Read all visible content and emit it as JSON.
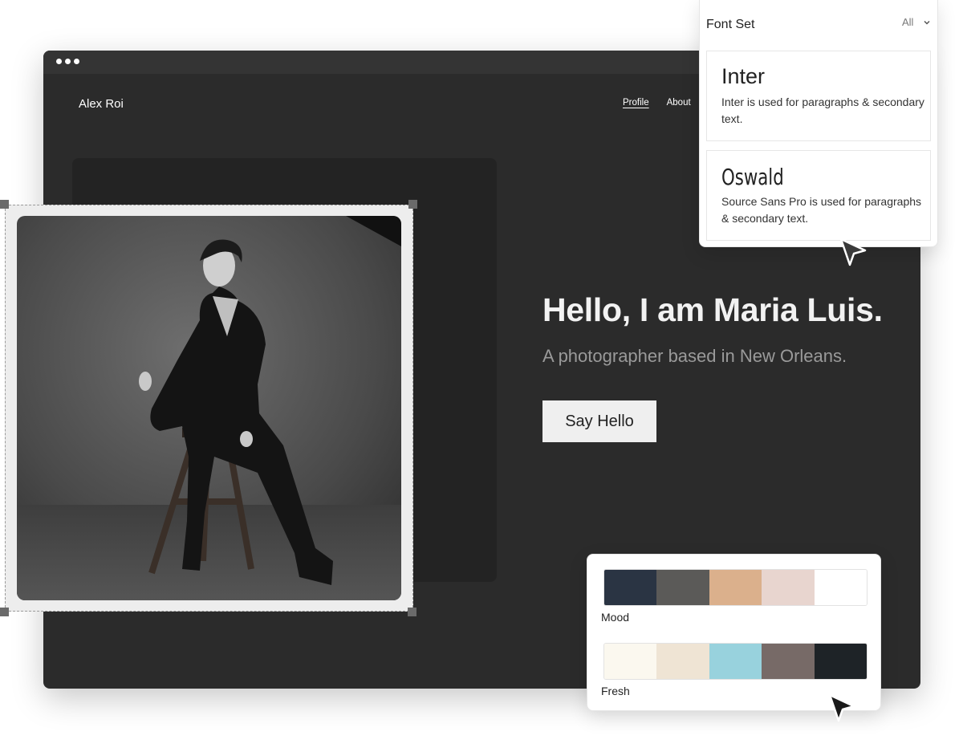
{
  "site": {
    "brand": "Alex Roi",
    "nav": [
      "Profile",
      "About"
    ],
    "hero_title": "Hello, I am Maria Luis.",
    "hero_subtitle": "A photographer based in New Orleans.",
    "cta_label": "Say Hello",
    "photo_icon": "portrait-photo-icon"
  },
  "font_panel": {
    "title": "Font Set",
    "filter": "All",
    "fonts": [
      {
        "name": "Inter",
        "description": "Inter is used for paragraphs & secondary text."
      },
      {
        "name": "Oswald",
        "description": "Source Sans Pro is used for paragraphs & secondary text."
      }
    ]
  },
  "palette_panel": {
    "palettes": [
      {
        "name": "Mood",
        "colors": [
          "#2a3443",
          "#5b5a58",
          "#dbb08c",
          "#e8d5cf",
          "#ffffff"
        ]
      },
      {
        "name": "Fresh",
        "colors": [
          "#fbf8ef",
          "#efe4d4",
          "#98d2dd",
          "#776a67",
          "#1e2327"
        ]
      }
    ]
  },
  "colors": {
    "window_bg": "#2b2b2b",
    "accent_text": "#f2f2f2",
    "muted_text": "#9a9a9a"
  }
}
